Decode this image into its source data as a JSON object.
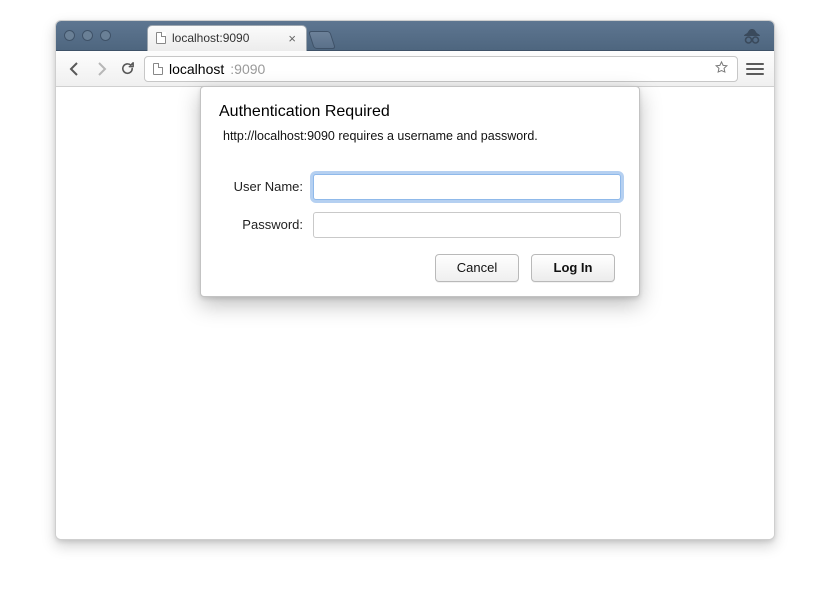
{
  "tab": {
    "title": "localhost:9090"
  },
  "address": {
    "host": "localhost",
    "port": ":9090"
  },
  "dialog": {
    "title": "Authentication Required",
    "message": "http://localhost:9090 requires a username and password.",
    "username_label": "User Name:",
    "password_label": "Password:",
    "username_value": "",
    "password_value": "",
    "cancel_label": "Cancel",
    "login_label": "Log In"
  }
}
